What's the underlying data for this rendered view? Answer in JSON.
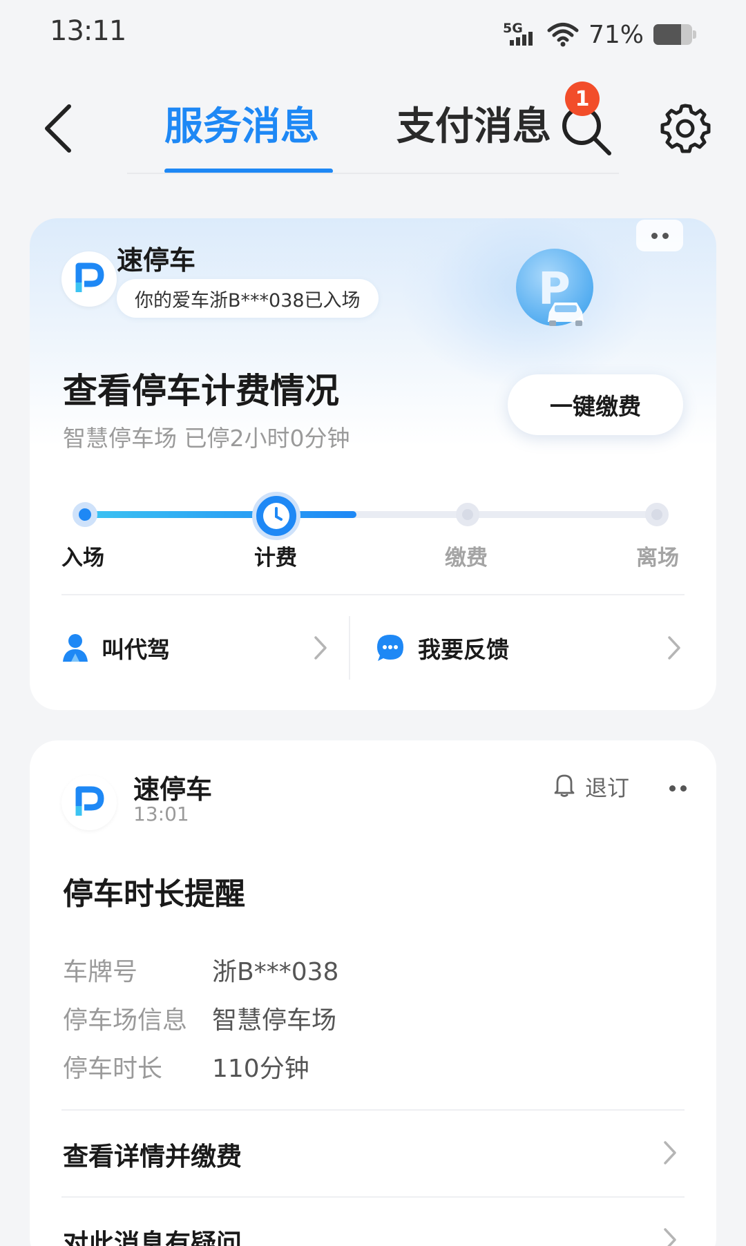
{
  "status_bar": {
    "time": "13:11",
    "network": "5G",
    "battery_text": "71%",
    "battery_level": 0.71,
    "icons": [
      "signal-5g-icon",
      "wifi-icon",
      "battery-icon"
    ]
  },
  "header": {
    "back_icon": "back-chevron-icon",
    "tabs": [
      {
        "label": "服务消息",
        "active": true
      },
      {
        "label": "支付消息",
        "active": false,
        "badge": "1"
      }
    ],
    "search_icon": "search-icon",
    "settings_icon": "gear-icon",
    "accent_color": "#1e88f5",
    "badge_color": "#f24d2a"
  },
  "parking_card": {
    "app_name": "速停车",
    "notice": "你的爱车浙B***038已入场",
    "title": "查看停车计费情况",
    "subtitle": "智慧停车场 已停2小时0分钟",
    "pay_button": "一键缴费",
    "steps": [
      {
        "label": "入场",
        "state": "done"
      },
      {
        "label": "计费",
        "state": "current"
      },
      {
        "label": "缴费",
        "state": "todo"
      },
      {
        "label": "离场",
        "state": "todo"
      }
    ],
    "progress": 0.47,
    "actions": [
      {
        "label": "叫代驾",
        "icon": "driver-person-icon"
      },
      {
        "label": "我要反馈",
        "icon": "chat-bubble-icon"
      }
    ]
  },
  "message_card": {
    "app_name": "速停车",
    "time": "13:01",
    "unsubscribe": "退订",
    "title": "停车时长提醒",
    "fields": [
      {
        "label": "车牌号",
        "value": "浙B***038"
      },
      {
        "label": "停车场信息",
        "value": "智慧停车场"
      },
      {
        "label": "停车时长",
        "value": "110分钟"
      }
    ],
    "links": [
      {
        "label": "查看详情并缴费"
      },
      {
        "label": "对此消息有疑问"
      }
    ]
  }
}
